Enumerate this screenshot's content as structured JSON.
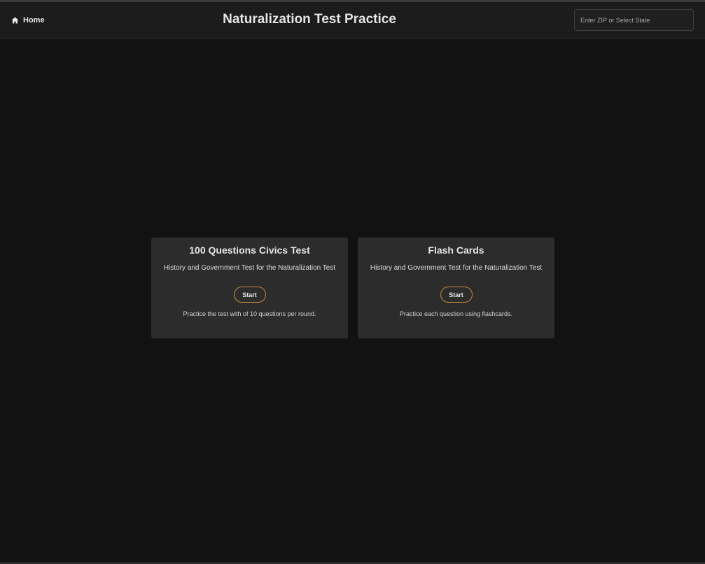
{
  "header": {
    "home_label": "Home",
    "title": "Naturalization Test Practice",
    "zip_placeholder": "Enter ZIP or Select State",
    "zip_value": ""
  },
  "cards": [
    {
      "title": "100 Questions Civics Test",
      "subtitle": "History and Government Test for the Naturalization Test",
      "button_label": "Start",
      "description": "Practice the test with of 10 questions per round."
    },
    {
      "title": "Flash Cards",
      "subtitle": "History and Government Test for the Naturalization Test",
      "button_label": "Start",
      "description": "Practice each question using flashcards."
    }
  ],
  "icons": {
    "home": "home-icon"
  },
  "colors": {
    "background": "#121212",
    "appbar": "#1c1c1c",
    "card": "#2c2c2c",
    "accent": "#c9873a"
  }
}
